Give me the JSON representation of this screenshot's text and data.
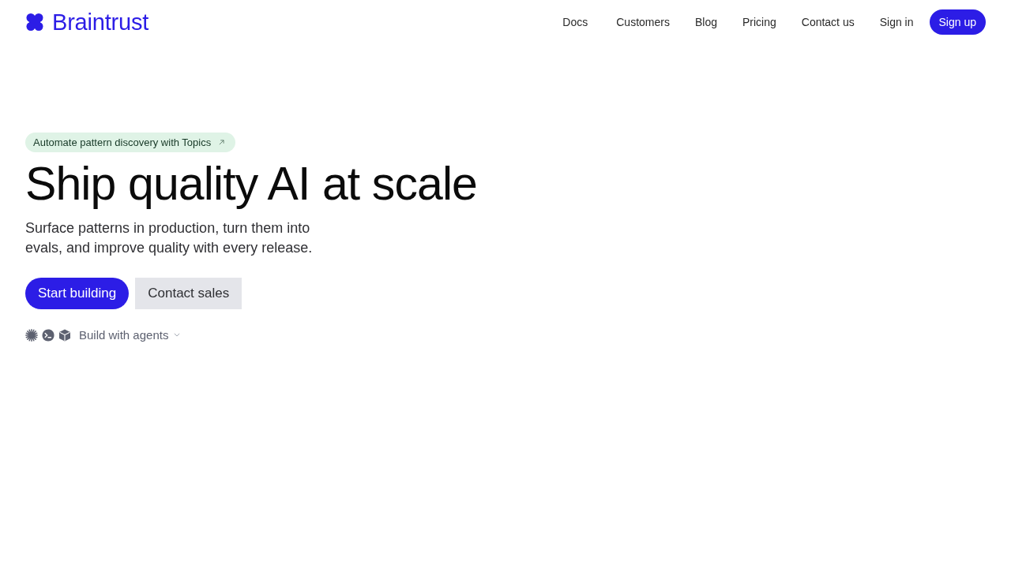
{
  "header": {
    "brand": "Braintrust",
    "nav": [
      "Docs",
      "Customers",
      "Blog",
      "Pricing",
      "Contact us",
      "Sign in"
    ],
    "cta": "Sign up"
  },
  "hero": {
    "badge": "Automate pattern discovery with Topics",
    "heading": "Ship quality AI at scale",
    "subtitle": "Surface patterns in production, turn them into evals, and improve quality with every release.",
    "buttons": [
      {
        "label": "Start building",
        "kind": "primary"
      },
      {
        "label": "Contact sales",
        "kind": "secondary"
      }
    ],
    "agents": {
      "label": "Build with agents"
    }
  }
}
